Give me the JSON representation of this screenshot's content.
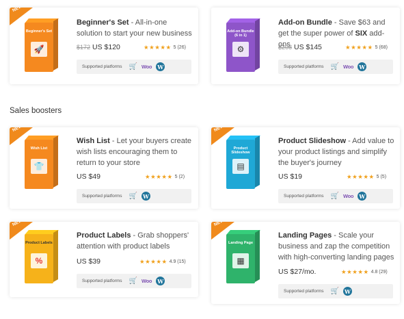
{
  "section": {
    "title": "Sales boosters"
  },
  "platforms_label": "Supported platforms",
  "woo_label": "Woo",
  "ribbon": "NEW",
  "colors": {
    "star": "#f0a01c",
    "ribbon": "#f08a1c",
    "woo": "#7f54b3",
    "wordpress": "#21759b"
  },
  "cards": [
    {
      "name": "Beginner's Set",
      "desc": " - All-in-one solution to start your new business",
      "box_label": "Beginner's Set",
      "box_color": "#f5891f",
      "old_price": "$172",
      "price": "US $120",
      "rating": "5",
      "reviews": "(26)",
      "woo": true,
      "icon": "rocket-icon"
    },
    {
      "name": "Add-on Bundle",
      "desc_pre": " - Save $63 and get the super power of ",
      "desc_bold": "SIX",
      "desc_post": " add-ons",
      "box_label": "Add-on Bundle (6 in 1)",
      "box_color": "#8e55c9",
      "old_price": "$208",
      "price": "US $145",
      "rating": "5",
      "reviews": "(68)",
      "woo": true,
      "icon": "gear-icon"
    },
    {
      "name": "Wish List",
      "desc": " - Let your buyers create wish lists encouraging them to return to your store",
      "box_label": "Wish List",
      "box_color": "#f5891f",
      "price": "US $49",
      "rating": "5",
      "reviews": "(2)",
      "woo": false,
      "icon": "shirt-heart-icon"
    },
    {
      "name": "Product Slideshow",
      "desc": " - Add value to your product listings and simplify the buyer's journey",
      "box_label": "Product Slideshow",
      "box_color": "#1fa8d6",
      "price": "US $19",
      "rating": "5",
      "reviews": "(5)",
      "woo": true,
      "icon": "slideshow-icon"
    },
    {
      "name": "Product Labels",
      "desc": " - Grab shoppers' attention with product labels",
      "box_label": "Product Labels",
      "box_color": "#f6b21a",
      "price": "US $39",
      "rating": "4.9",
      "reviews": "(15)",
      "woo": true,
      "icon": "percent-tag-icon"
    },
    {
      "name": "Landing Pages",
      "desc": " - Scale your business and zap the competition with high-converting landing pages",
      "box_label": "Landing Page",
      "box_color": "#2fb36b",
      "price": "US $27/mo.",
      "rating": "4.8",
      "reviews": "(29)",
      "woo": false,
      "icon": "landing-page-icon"
    }
  ]
}
